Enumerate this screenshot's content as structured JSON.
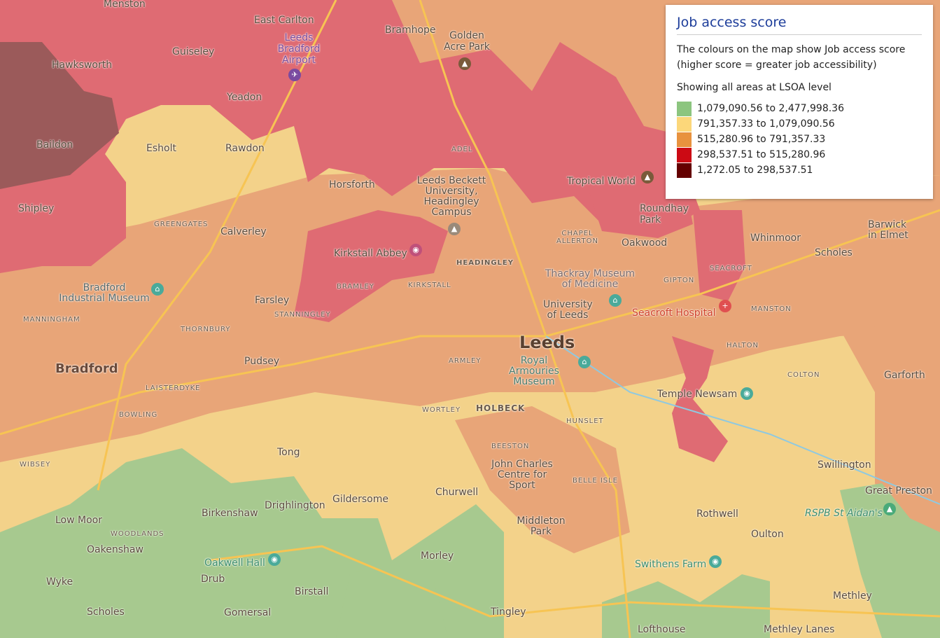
{
  "legend": {
    "title": "Job access score",
    "description": "The colours on the map show Job access score (higher score = greater job accessibility)",
    "level_note": "Showing all areas at LSOA level",
    "classes": [
      {
        "label": "1,079,090.56 to 2,477,998.36",
        "color": "#8cc57f"
      },
      {
        "label": "791,357.33 to 1,079,090.56",
        "color": "#fcd77a"
      },
      {
        "label": "515,280.96 to 791,357.33",
        "color": "#e8923e"
      },
      {
        "label": "298,537.51 to 515,280.96",
        "color": "#cc0a14"
      },
      {
        "label": "1,272.05 to 298,537.51",
        "color": "#640000"
      }
    ]
  },
  "map": {
    "labels": [
      "Menston",
      "East Carlton",
      "Leeds Bradford Airport",
      "Bramhope",
      "Golden Acre Park",
      "Guiseley",
      "Hawksworth",
      "Yeadon",
      "Baildon",
      "Esholt",
      "Rawdon",
      "Horsforth",
      "Leeds Beckett University, Headingley Campus",
      "Tropical World",
      "Roundhay Park",
      "Shipley",
      "Calverley",
      "Kirkstall Abbey",
      "HEADINGLEY",
      "Oakwood",
      "Whinmoor",
      "Scholes",
      "Barwick in Elmet",
      "Bradford Industrial Museum",
      "Farsley",
      "Thackray Museum of Medicine",
      "University of Leeds",
      "Seacroft Hospital",
      "Leeds",
      "Royal Armouries Museum",
      "Bradford",
      "Pudsey",
      "Temple Newsam",
      "Garforth",
      "HOLBECK",
      "Tong",
      "John Charles Centre for Sport",
      "Swillington",
      "Churwell",
      "Great Preston",
      "Drighlington",
      "Gildersome",
      "Low Moor",
      "Birkenshaw",
      "Middleton Park",
      "Rothwell",
      "RSPB St Aidan's",
      "Oakenshaw",
      "Oulton",
      "Oakwell Hall",
      "Swithens Farm",
      "Morley",
      "Wyke",
      "Drub",
      "Birstall",
      "Methley",
      "Scholes",
      "Gomersal",
      "Tingley",
      "Lofthouse",
      "Methley Lanes",
      "MANNINGHAM",
      "THORNBURY",
      "LAISTERDYKE",
      "BOWLING",
      "WIBSEY",
      "ARMLEY",
      "WORTLEY",
      "BEESTON",
      "HUNSLET",
      "BELLE ISLE",
      "CHAPEL ALLERTON",
      "GIPTON",
      "HALTON",
      "COLTON",
      "SEACROFT",
      "MANSTON",
      "BRAMLEY",
      "STANNINGLEY",
      "GREENGATES",
      "WOODLANDS",
      "ADEL",
      "KIRKSTALL"
    ],
    "region_colors": {
      "pink": "#df6b73",
      "orange": "#e8a578",
      "yellow": "#f3d28a",
      "green": "#a7c98f",
      "dark": "#9b5a5a"
    }
  }
}
